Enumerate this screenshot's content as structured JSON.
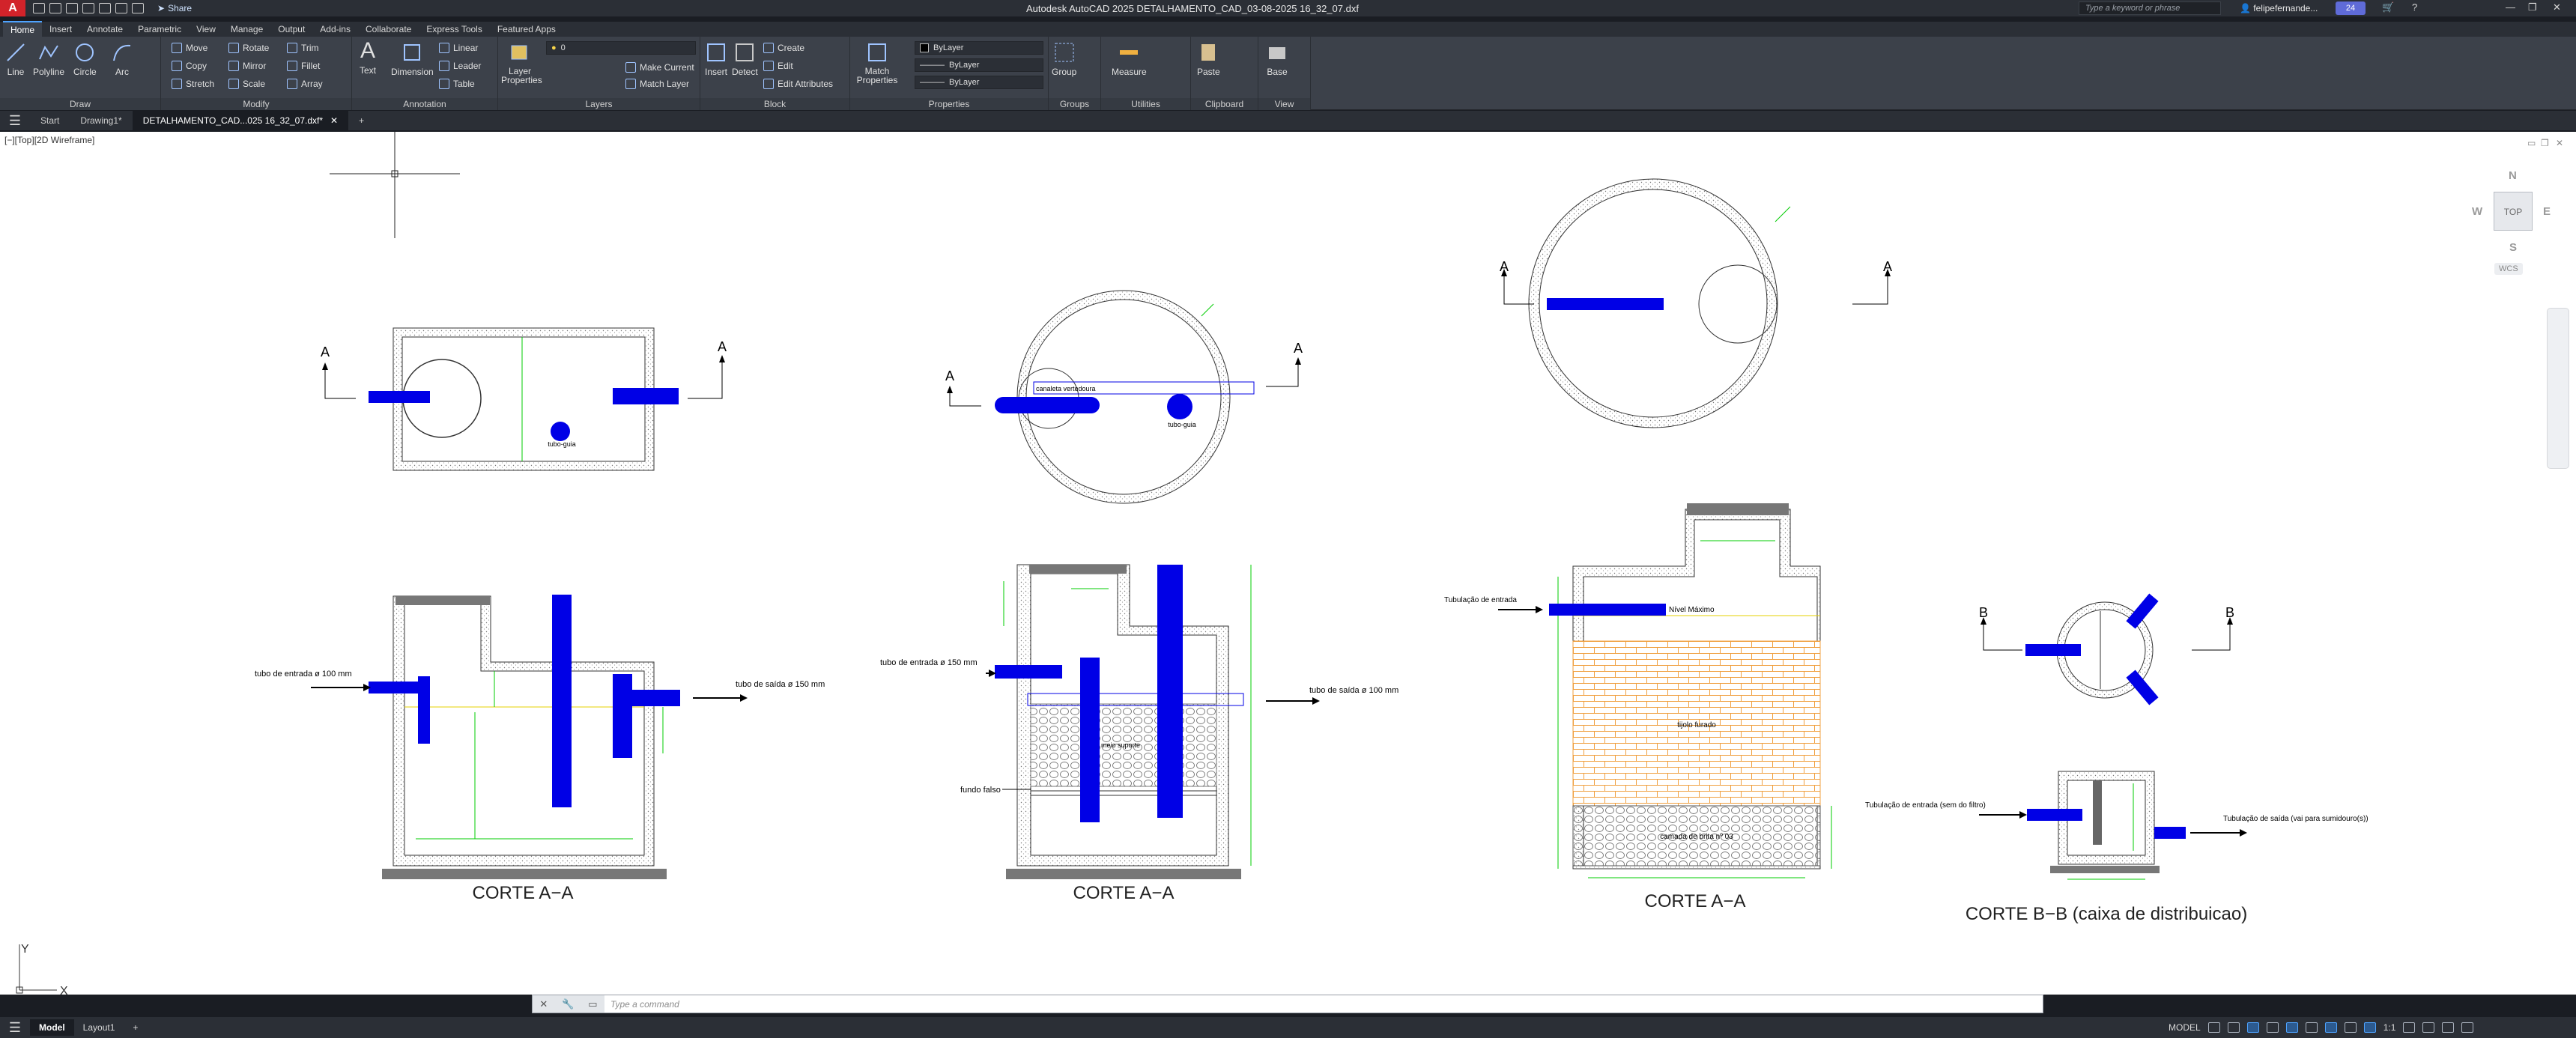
{
  "titlebar": {
    "logo": "A",
    "share_label": "Share",
    "title": "Autodesk AutoCAD 2025   DETALHAMENTO_CAD_03-08-2025 16_32_07.dxf",
    "search_placeholder": "Type a keyword or phrase",
    "user": "felipefernande...",
    "clock_badge": "24",
    "minimize": "—",
    "restore": "❐",
    "close": "✕"
  },
  "ribbon_tabs": [
    "Home",
    "Insert",
    "Annotate",
    "Parametric",
    "View",
    "Manage",
    "Output",
    "Add-ins",
    "Collaborate",
    "Express Tools",
    "Featured Apps"
  ],
  "ribbon": {
    "draw": {
      "title": "Draw",
      "line": "Line",
      "polyline": "Polyline",
      "circle": "Circle",
      "arc": "Arc"
    },
    "modify": {
      "title": "Modify",
      "move": "Move",
      "rotate": "Rotate",
      "trim": "Trim",
      "copy": "Copy",
      "mirror": "Mirror",
      "fillet": "Fillet",
      "stretch": "Stretch",
      "scale": "Scale",
      "array": "Array"
    },
    "annotation": {
      "title": "Annotation",
      "text": "Text",
      "dimension": "Dimension",
      "linear": "Linear",
      "leader": "Leader",
      "table": "Table"
    },
    "layers": {
      "title": "Layers",
      "layer_properties": "Layer Properties",
      "layer_value": "0",
      "make_current": "Make Current",
      "match_layer": "Match Layer"
    },
    "block": {
      "title": "Block",
      "insert": "Insert",
      "detect": "Detect",
      "create": "Create",
      "edit": "Edit",
      "edit_attributes": "Edit Attributes"
    },
    "properties": {
      "title": "Properties",
      "match_properties": "Match Properties",
      "color": "ByLayer",
      "linetype": "ByLayer",
      "lineweight": "ByLayer"
    },
    "groups": {
      "title": "Groups",
      "group": "Group"
    },
    "utilities": {
      "title": "Utilities",
      "measure": "Measure"
    },
    "clipboard": {
      "title": "Clipboard",
      "paste": "Paste"
    },
    "view": {
      "title": "View",
      "base": "Base"
    }
  },
  "filetabs": {
    "start": "Start",
    "drawing1": "Drawing1*",
    "active": "DETALHAMENTO_CAD...025 16_32_07.dxf*",
    "add": "+"
  },
  "viewport": {
    "label": "[−][Top][2D Wireframe]",
    "viewcube": {
      "n": "N",
      "s": "S",
      "e": "E",
      "w": "W",
      "top": "TOP",
      "wcs": "WCS"
    }
  },
  "drawing": {
    "section_mark": "A",
    "section_mark_b": "B",
    "tubo_guia": "tubo-guia",
    "canaleta": "canaleta vertedoura",
    "corte_aa": "CORTE A−A",
    "corte_bb": "CORTE B−B (caixa de distribuicao)",
    "tubo_entrada_100": "tubo de entrada ø 100 mm",
    "tubo_saida_150": "tubo de saída ø 150 mm",
    "tubo_entrada_150": "tubo de entrada ø 150 mm",
    "tubo_saida_100": "tubo de saída ø 100 mm",
    "fundo_falso": "fundo falso",
    "meio_suporte": "meio suporte",
    "tubulacao_entrada": "Tubulação de entrada",
    "nivel": "Nível Máximo",
    "tijolo": "tijolo furado",
    "camada": "camada de brita nº 03",
    "entrada_filtro": "Tubulação de entrada (sem do filtro)",
    "saida_sumidouro": "Tubulação de saída (vai para sumidouro(s))"
  },
  "cmdline": {
    "placeholder": "Type a command"
  },
  "statusbar": {
    "model": "Model",
    "layout1": "Layout1",
    "add": "+",
    "model_mode": "MODEL",
    "scale": "1:1"
  },
  "colors": {
    "pipe": "#0000e6",
    "dim": "#00cc00",
    "brick": "#f0a040",
    "gray": "#888888"
  }
}
